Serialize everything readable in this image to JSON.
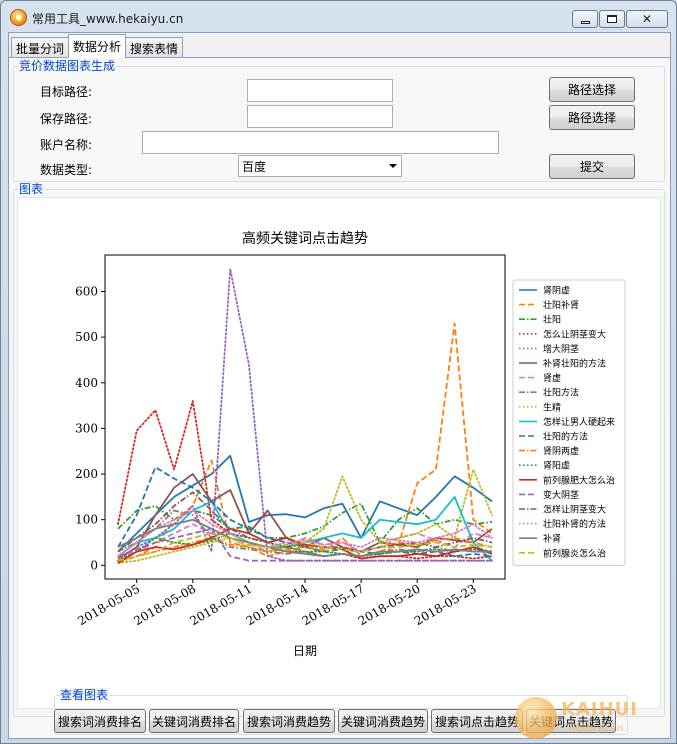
{
  "window": {
    "title": "常用工具_www.hekaiyu.cn"
  },
  "tabs": [
    {
      "label": "批量分词"
    },
    {
      "label": "数据分析"
    },
    {
      "label": "搜索表情"
    }
  ],
  "form_group": {
    "legend": "竞价数据图表生成",
    "target_path_label": "目标路径:",
    "target_path_value": "",
    "save_path_label": "保存路径:",
    "save_path_value": "",
    "account_label": "账户名称:",
    "account_value": "",
    "data_type_label": "数据类型:",
    "data_type_value": "百度",
    "path_select_1": "路径选择",
    "path_select_2": "路径选择",
    "submit": "提交"
  },
  "chart_group": {
    "legend": "图表"
  },
  "view_group": {
    "legend": "查看图表",
    "buttons": [
      "搜索词消费排名",
      "关键词消费排名",
      "搜索词消费趋势",
      "关键词消费趋势",
      "搜索词点击趋势",
      "关键词点击趋势"
    ]
  },
  "watermark": {
    "brand": "KAIHUI",
    "site": "hekaiyu.cn"
  },
  "chart_data": {
    "type": "line",
    "title": "高频关键词点击趋势",
    "xlabel": "日期",
    "ylabel": "",
    "x": [
      "2018-05-04",
      "2018-05-05",
      "2018-05-06",
      "2018-05-07",
      "2018-05-08",
      "2018-05-09",
      "2018-05-10",
      "2018-05-11",
      "2018-05-12",
      "2018-05-13",
      "2018-05-14",
      "2018-05-15",
      "2018-05-16",
      "2018-05-17",
      "2018-05-18",
      "2018-05-19",
      "2018-05-20",
      "2018-05-21",
      "2018-05-22",
      "2018-05-23",
      "2018-05-24"
    ],
    "xticks": [
      "2018-05-05",
      "2018-05-08",
      "2018-05-11",
      "2018-05-14",
      "2018-05-17",
      "2018-05-20",
      "2018-05-23"
    ],
    "ylim": [
      -30,
      680
    ],
    "yticks": [
      0,
      100,
      200,
      300,
      400,
      500,
      600
    ],
    "legend_position": "right",
    "series": [
      {
        "name": "肾阴虚",
        "color": "#1f77b4",
        "dash": "solid",
        "values": [
          30,
          70,
          110,
          150,
          175,
          200,
          240,
          95,
          110,
          112,
          105,
          125,
          135,
          60,
          140,
          125,
          110,
          150,
          195,
          170,
          140
        ]
      },
      {
        "name": "壮阳补肾",
        "color": "#ff7f0e",
        "dash": "dashed",
        "values": [
          10,
          20,
          40,
          100,
          130,
          230,
          50,
          40,
          20,
          30,
          40,
          30,
          60,
          20,
          30,
          45,
          180,
          210,
          530,
          100,
          70
        ]
      },
      {
        "name": "壮阳",
        "color": "#2ca02c",
        "dash": "dashdot",
        "values": [
          80,
          120,
          130,
          100,
          120,
          110,
          80,
          85,
          60,
          60,
          70,
          85,
          115,
          135,
          50,
          100,
          125,
          90,
          100,
          90,
          95
        ]
      },
      {
        "name": "怎么让阴茎变大",
        "color": "#d62728",
        "dash": "dotted",
        "values": [
          90,
          295,
          340,
          210,
          360,
          100,
          70,
          50,
          40,
          30,
          30,
          20,
          25,
          15,
          20,
          20,
          15,
          20,
          20,
          15,
          20
        ]
      },
      {
        "name": "增大阴茎",
        "color": "#9467bd",
        "dash": "dotted",
        "values": [
          10,
          40,
          60,
          90,
          130,
          30,
          650,
          440,
          20,
          10,
          10,
          10,
          10,
          10,
          10,
          10,
          10,
          10,
          10,
          10,
          10
        ]
      },
      {
        "name": "补肾壮阳的方法",
        "color": "#8c564b",
        "dash": "solid",
        "values": [
          15,
          40,
          110,
          170,
          200,
          140,
          165,
          70,
          120,
          60,
          40,
          60,
          40,
          30,
          50,
          45,
          40,
          60,
          55,
          50,
          80
        ]
      },
      {
        "name": "肾虚",
        "color": "#e377c2",
        "dash": "dashed",
        "values": [
          20,
          30,
          50,
          70,
          90,
          70,
          70,
          50,
          30,
          40,
          60,
          45,
          50,
          30,
          40,
          60,
          70,
          55,
          40,
          70,
          60
        ]
      },
      {
        "name": "壮阳方法",
        "color": "#7f7f7f",
        "dash": "dashdot",
        "values": [
          30,
          50,
          80,
          120,
          110,
          60,
          40,
          35,
          30,
          25,
          30,
          20,
          25,
          20,
          30,
          35,
          30,
          40,
          30,
          40,
          30
        ]
      },
      {
        "name": "生精",
        "color": "#bcbd22",
        "dash": "dotted",
        "values": [
          5,
          10,
          20,
          30,
          40,
          50,
          60,
          40,
          30,
          40,
          50,
          80,
          195,
          100,
          50,
          60,
          70,
          90,
          60,
          210,
          110
        ]
      },
      {
        "name": "怎样让男人硬起来",
        "color": "#17becf",
        "dash": "solid",
        "values": [
          20,
          50,
          60,
          80,
          120,
          140,
          70,
          50,
          40,
          40,
          50,
          60,
          70,
          60,
          100,
          95,
          90,
          100,
          150,
          50,
          10
        ]
      },
      {
        "name": "壮阳的方法",
        "color": "#1f77b4",
        "dash": "dashed",
        "values": [
          40,
          110,
          215,
          190,
          170,
          140,
          100,
          80,
          60,
          50,
          40,
          30,
          35,
          30,
          25,
          30,
          25,
          30,
          20,
          25,
          20
        ]
      },
      {
        "name": "肾阴两虚",
        "color": "#ff7f0e",
        "dash": "dashdot",
        "values": [
          5,
          20,
          30,
          40,
          50,
          60,
          45,
          40,
          30,
          35,
          40,
          35,
          40,
          30,
          40,
          50,
          45,
          55,
          60,
          50,
          40
        ]
      },
      {
        "name": "肾阳虚",
        "color": "#2ca02c",
        "dash": "dotted",
        "values": [
          10,
          30,
          60,
          50,
          45,
          55,
          70,
          60,
          50,
          40,
          30,
          30,
          25,
          20,
          25,
          30,
          30,
          35,
          30,
          35,
          30
        ]
      },
      {
        "name": "前列腺肥大怎么治",
        "color": "#d62728",
        "dash": "solid",
        "values": [
          5,
          30,
          40,
          35,
          45,
          60,
          80,
          70,
          50,
          60,
          45,
          40,
          35,
          15,
          20,
          20,
          25,
          20,
          30,
          40,
          25
        ]
      },
      {
        "name": "变大阴茎",
        "color": "#9467bd",
        "dash": "dashed",
        "values": [
          20,
          35,
          50,
          60,
          70,
          80,
          20,
          10,
          10,
          10,
          10,
          10,
          10,
          10,
          10,
          10,
          10,
          10,
          10,
          10,
          10
        ]
      },
      {
        "name": "怎样让阴茎变大",
        "color": "#8c564b",
        "dash": "dashdot",
        "values": [
          30,
          60,
          90,
          130,
          160,
          120,
          80,
          60,
          50,
          40,
          45,
          40,
          40,
          30,
          40,
          45,
          50,
          40,
          50,
          60,
          50
        ]
      },
      {
        "name": "壮阳补肾的方法",
        "color": "#e377c2",
        "dash": "dotted",
        "values": [
          20,
          50,
          80,
          100,
          120,
          90,
          70,
          50,
          40,
          50,
          55,
          45,
          50,
          40,
          60,
          55,
          50,
          60,
          70,
          90,
          60
        ]
      },
      {
        "name": "补肾",
        "color": "#7f7f7f",
        "dash": "solid",
        "values": [
          40,
          60,
          80,
          90,
          100,
          80,
          60,
          50,
          40,
          30,
          25,
          20,
          25,
          20,
          30,
          30,
          35,
          30,
          35,
          30,
          30
        ]
      },
      {
        "name": "前列腺炎怎么治",
        "color": "#bcbd22",
        "dash": "dashed",
        "values": [
          10,
          20,
          30,
          50,
          60,
          70,
          60,
          45,
          40,
          45,
          50,
          40,
          35,
          30,
          40,
          40,
          45,
          50,
          40,
          45,
          40
        ]
      }
    ]
  }
}
